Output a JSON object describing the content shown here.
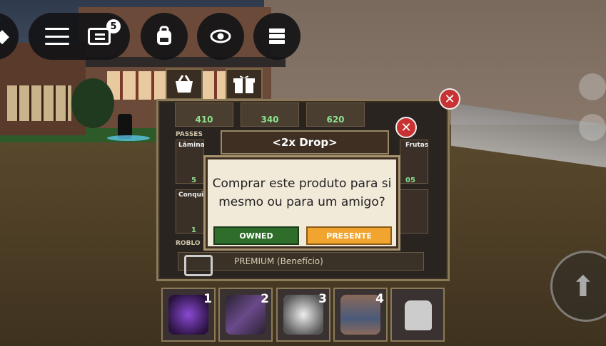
{
  "topbar": {
    "chat_badge": "5",
    "icons": [
      "roblox-logo-icon",
      "menu-icon",
      "chat-icon",
      "backpack-icon",
      "eye-icon",
      "server-list-icon"
    ]
  },
  "shop": {
    "tab_icons": [
      "basket-icon",
      "gift-icon"
    ],
    "prices_top": [
      "410",
      "340",
      "620"
    ],
    "section_passes": "PASSES",
    "section_roblox": "ROBLO",
    "left_cards": [
      {
        "title": "Lâmina",
        "price": "5"
      },
      {
        "title": "Conqui",
        "price": "1"
      }
    ],
    "right_cards": [
      {
        "title": "Frutas",
        "price": "05"
      }
    ],
    "premium_label": "PREMIUM (Benefício)"
  },
  "dialog": {
    "title": "<2x Drop>",
    "question": "Comprar este produto para si mesmo ou para um amigo?",
    "owned_label": "OWNED",
    "present_label": "PRESENTE"
  },
  "hotbar": {
    "slots": [
      {
        "num": "1",
        "icon": "shadow-fruit-icon",
        "color": "#5a2e8a"
      },
      {
        "num": "2",
        "icon": "sword-icon",
        "color": "#6a4a8a"
      },
      {
        "num": "3",
        "icon": "cards-hand-icon",
        "color": "#ddd"
      },
      {
        "num": "4",
        "icon": "hourglass-icon",
        "color": "#8a6a5a"
      },
      {
        "num": "",
        "icon": "backpack-icon",
        "color": "#ccc"
      }
    ]
  },
  "colors": {
    "owned": "#2e6e2a",
    "present": "#f2a52e",
    "close": "#c83232",
    "price_green": "#8ee08e"
  }
}
